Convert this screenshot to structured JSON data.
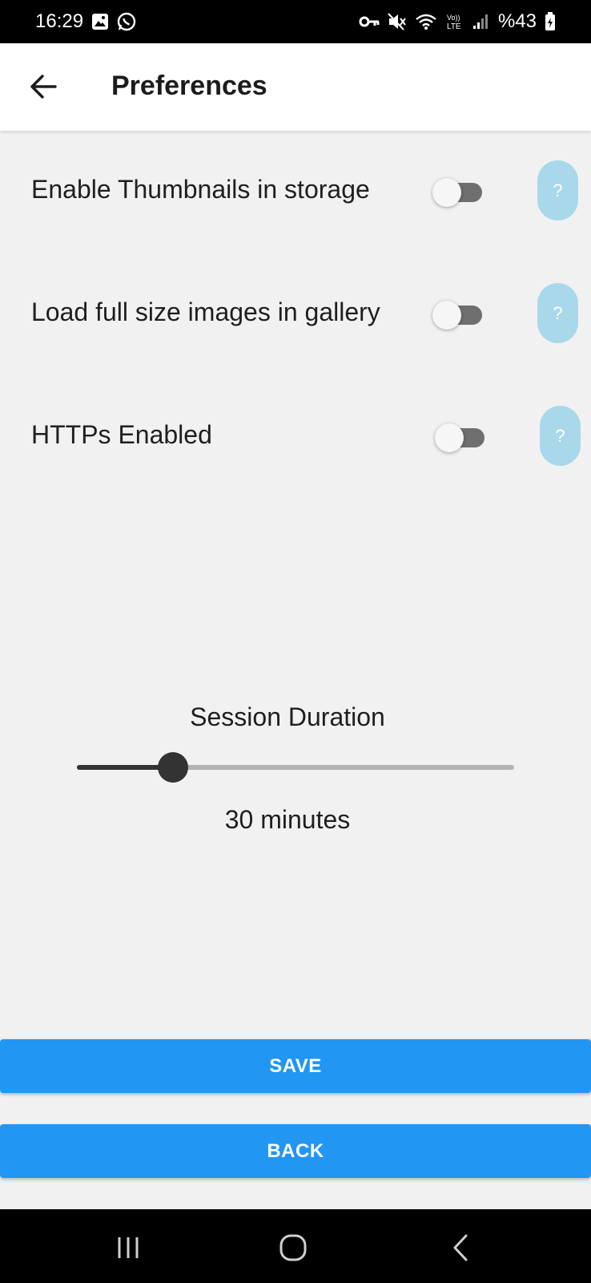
{
  "status_bar": {
    "time": "16:29",
    "battery": "%43",
    "icons": [
      "gallery-icon",
      "whatsapp-icon",
      "key-icon",
      "mute-icon",
      "wifi-icon",
      "volte-icon",
      "signal-icon",
      "battery-icon"
    ],
    "volte_label": "Vo))\nLTE"
  },
  "app_bar": {
    "title": "Preferences",
    "back_icon": "arrow-left-icon"
  },
  "preferences": [
    {
      "label": "Enable Thumbnails in storage",
      "enabled": false,
      "help": "?"
    },
    {
      "label": "Load full size images in gallery",
      "enabled": false,
      "help": "?"
    },
    {
      "label": "HTTPs Enabled",
      "enabled": false,
      "help": "?"
    }
  ],
  "session": {
    "title": "Session Duration",
    "value_label": "30 minutes",
    "slider_fraction": 0.22
  },
  "buttons": {
    "save": "SAVE",
    "back": "BACK"
  },
  "colors": {
    "accent": "#2196f3",
    "help_button": "#a8d8ea",
    "toggle_track_off": "#6f6f6f",
    "background": "#f1f1f1"
  },
  "nav_bar": {
    "icons": [
      "recents-icon",
      "home-icon",
      "back-icon"
    ]
  }
}
